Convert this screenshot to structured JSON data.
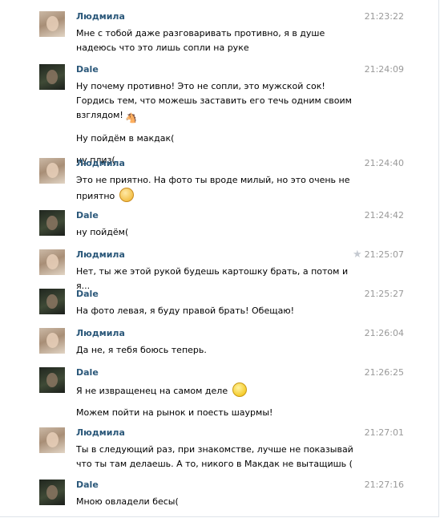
{
  "messages": [
    {
      "author": "Людмила",
      "time": "21:23:22",
      "starred": false,
      "lines": [
        "Мне с тобой даже разговаривать противно, я в душе надеюсь что это лишь сопли на руке"
      ]
    },
    {
      "author": "Dale",
      "time": "21:24:09",
      "starred": false,
      "lines": [
        "Ну почему противно! Это не сопли, это мужской сок! Гордись тем, что можешь заставить его течь одним своим взглядом!",
        "Ну пойдём в макдак(",
        "ну плиз("
      ]
    },
    {
      "author": "Людмила",
      "time": "21:24:40",
      "starred": false,
      "lines": [
        "Это не приятно. На фото ты вроде милый, но это очень не приятно"
      ]
    },
    {
      "author": "Dale",
      "time": "21:24:42",
      "starred": false,
      "lines": [
        "ну пойдём("
      ]
    },
    {
      "author": "Людмила",
      "time": "21:25:07",
      "starred": true,
      "lines": [
        "Нет, ты же этой рукой будешь картошку брать, а потом и я..."
      ]
    },
    {
      "author": "Dale",
      "time": "21:25:27",
      "starred": false,
      "lines": [
        "На фото левая, я буду правой брать! Обещаю!"
      ]
    },
    {
      "author": "Людмила",
      "time": "21:26:04",
      "starred": false,
      "lines": [
        "Да не, я тебя боюсь теперь."
      ]
    },
    {
      "author": "Dale",
      "time": "21:26:25",
      "starred": false,
      "lines": [
        "Я не извращенец на самом деле",
        "Можем пойти на рынок и поесть шаурмы!"
      ]
    },
    {
      "author": "Людмила",
      "time": "21:27:01",
      "starred": false,
      "lines": [
        "Ты в следующий раз, при знакомстве, лучше не показывай что ты там делаешь. А то, никого в Макдак не вытащишь ("
      ]
    },
    {
      "author": "Dale",
      "time": "21:27:16",
      "starred": false,
      "lines": [
        "Мною овладели бесы("
      ]
    }
  ],
  "icons": {
    "star": "star-icon",
    "emoji_horse": "horse-emoji-icon",
    "emoji_blush": "flushed-emoji-icon",
    "emoji_smile": "smile-emoji-icon"
  },
  "colors": {
    "author": "#2b587a",
    "time": "#999999",
    "text": "#000000",
    "star": "#c5cad1"
  }
}
